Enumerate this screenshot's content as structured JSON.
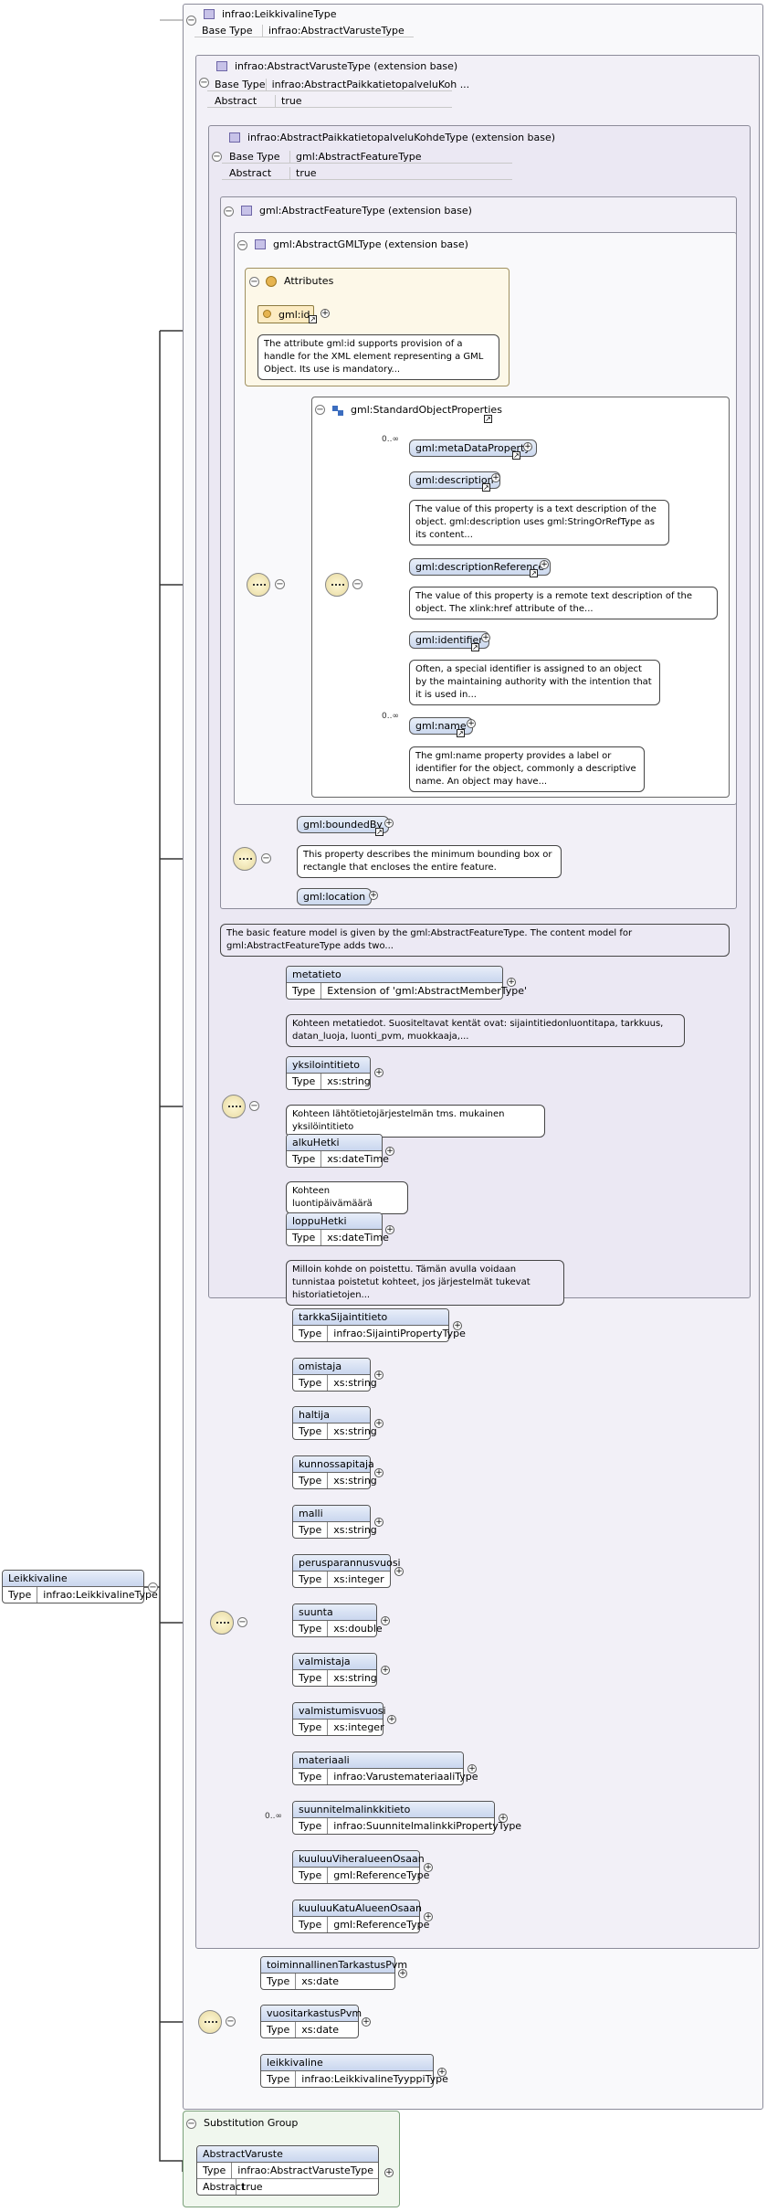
{
  "root": {
    "name": "Leikkivaline",
    "type_label": "Type",
    "type_value": "infrao:LeikkivalineType"
  },
  "complex_type": {
    "title": "infrao:LeikkivalineType",
    "base_label": "Base Type",
    "base_value": "infrao:AbstractVarusteType"
  },
  "ext1": {
    "title": "infrao:AbstractVarusteType (extension base)",
    "base_label": "Base Type",
    "base_value": "infrao:AbstractPaikkatietopalveluKoh ...",
    "abstract_label": "Abstract",
    "abstract_value": "true"
  },
  "ext2": {
    "title": "infrao:AbstractPaikkatietopalveluKohdeType (extension base)",
    "base_label": "Base Type",
    "base_value": "gml:AbstractFeatureType",
    "abstract_label": "Abstract",
    "abstract_value": "true"
  },
  "ext3": {
    "title": "gml:AbstractFeatureType (extension base)"
  },
  "ext4": {
    "title": "gml:AbstractGMLType (extension base)"
  },
  "attributes": {
    "title": "Attributes",
    "id_name": "gml:id",
    "id_doc": "The attribute gml:id supports provision of a handle for the XML element representing a GML Object. Its use is mandatory..."
  },
  "std_props": {
    "title": "gml:StandardObjectProperties",
    "items": [
      {
        "name": "gml:metaDataProperty",
        "mult": "0..∞",
        "doc": ""
      },
      {
        "name": "gml:description",
        "mult": "",
        "doc": "The value of this property is a text description of the object. gml:description uses gml:StringOrRefType as its content..."
      },
      {
        "name": "gml:descriptionReference",
        "mult": "",
        "doc": "The value of this property is a remote text description of the object. The xlink:href attribute of the..."
      },
      {
        "name": "gml:identifier",
        "mult": "",
        "doc": "Often, a special identifier is assigned to an object by the maintaining authority with the intention that it is used in..."
      },
      {
        "name": "gml:name",
        "mult": "0..∞",
        "doc": "The gml:name property provides a label or identifier for the object, commonly a descriptive name. An object may have..."
      }
    ]
  },
  "feature_props": {
    "bounded_by": "gml:boundedBy",
    "bounded_by_doc": "This property describes the minimum bounding box or rectangle that encloses the entire feature.",
    "location": "gml:location"
  },
  "feature_doc": "The basic feature model is given by the gml:AbstractFeatureType. The content model for gml:AbstractFeatureType adds two...",
  "pkohde_props": [
    {
      "name": "metatieto",
      "type": "Extension of 'gml:AbstractMemberType'",
      "doc": "Kohteen metatiedot. Suositeltavat kentät ovat: sijaintitiedonluontitapa, tarkkuus, datan_luoja, luonti_pvm, muokkaaja,..."
    },
    {
      "name": "yksilointitieto",
      "type": "xs:string",
      "doc": "Kohteen lähtötietojärjestelmän tms. mukainen yksilöintitieto"
    },
    {
      "name": "alkuHetki",
      "type": "xs:dateTime",
      "doc": "Kohteen luontipäivämäärä"
    },
    {
      "name": "loppuHetki",
      "type": "xs:dateTime",
      "doc": "Milloin kohde on poistettu. Tämän avulla voidaan tunnistaa poistetut kohteet, jos järjestelmät tukevat historiatietojen..."
    }
  ],
  "varuste_props": [
    {
      "name": "tarkkaSijaintitieto",
      "type": "infrao:SijaintiPropertyType",
      "mult": ""
    },
    {
      "name": "omistaja",
      "type": "xs:string",
      "mult": ""
    },
    {
      "name": "haltija",
      "type": "xs:string",
      "mult": ""
    },
    {
      "name": "kunnossapitaja",
      "type": "xs:string",
      "mult": ""
    },
    {
      "name": "malli",
      "type": "xs:string",
      "mult": ""
    },
    {
      "name": "perusparannusvuosi",
      "type": "xs:integer",
      "mult": ""
    },
    {
      "name": "suunta",
      "type": "xs:double",
      "mult": ""
    },
    {
      "name": "valmistaja",
      "type": "xs:string",
      "mult": ""
    },
    {
      "name": "valmistumisvuosi",
      "type": "xs:integer",
      "mult": ""
    },
    {
      "name": "materiaali",
      "type": "infrao:VarustemateriaaliType",
      "mult": ""
    },
    {
      "name": "suunnitelmalinkkitieto",
      "type": "infrao:SuunnitelmalinkkiPropertyType",
      "mult": "0..∞"
    },
    {
      "name": "kuuluuViheralueenOsaan",
      "type": "gml:ReferenceType",
      "mult": ""
    },
    {
      "name": "kuuluuKatuAlueenOsaan",
      "type": "gml:ReferenceType",
      "mult": ""
    }
  ],
  "own_props": [
    {
      "name": "toiminnallinenTarkastusPvm",
      "type": "xs:date"
    },
    {
      "name": "vuositarkastusPvm",
      "type": "xs:date"
    },
    {
      "name": "leikkivaline",
      "type": "infrao:LeikkivalineTyyppiType"
    }
  ],
  "subst": {
    "title": "Substitution Group",
    "name": "AbstractVaruste",
    "type_label": "Type",
    "type_value": "infrao:AbstractVarusteType",
    "abstract_label": "Abstract",
    "abstract_value": "true"
  }
}
